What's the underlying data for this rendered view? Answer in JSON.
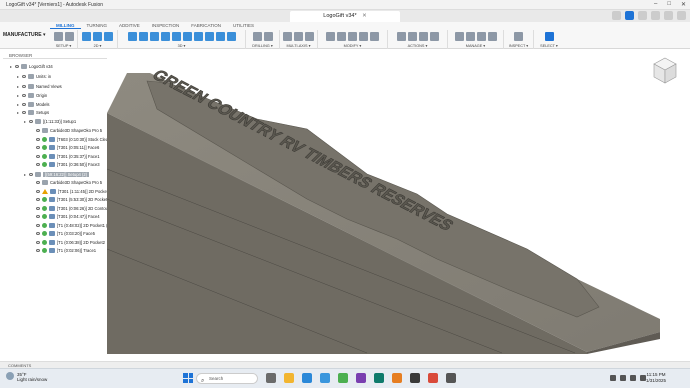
{
  "window": {
    "title": "LogoGift v34* [Verniers1] - Autodesk Fusion",
    "controls": [
      "–",
      "□",
      "✕"
    ]
  },
  "doc_tab": {
    "label": "LogoGift v34*",
    "close": "✕"
  },
  "ribbon": {
    "workspace": "MANUFACTURE ▾",
    "tabs": [
      "MILLING",
      "TURNING",
      "ADDITIVE",
      "INSPECTION",
      "FABRICATION",
      "UTILITIES"
    ],
    "active_tab": "MILLING",
    "groups": [
      "SETUP ▾",
      "2D ▾",
      "3D ▾",
      "DRILLING ▾",
      "MULTI-AXIS ▾",
      "MODIFY ▾",
      "ACTIONS ▾",
      "MANAGE ▾",
      "INSPECT ▾",
      "SELECT ▾"
    ]
  },
  "browser": {
    "header": "BROWSER",
    "rows": [
      {
        "label": "LogoGift v34",
        "indent": 0
      },
      {
        "label": "Units: in",
        "indent": 1
      },
      {
        "label": "Named Views",
        "indent": 1
      },
      {
        "label": "Origin",
        "indent": 1
      },
      {
        "label": "Models",
        "indent": 1
      },
      {
        "label": "Setups",
        "indent": 1
      },
      {
        "label": "[(1:11:33)] Setup1",
        "indent": 2
      },
      {
        "label": "Carbide3D ShapeOko Pro 5",
        "indent": 3
      },
      {
        "label": "[T603 (0:10:30)] Stock Clean",
        "indent": 3
      },
      {
        "label": "[T301 (0:05:11)] Face6",
        "indent": 3
      },
      {
        "label": "[T301 (0:35:37)] Face1",
        "indent": 3
      },
      {
        "label": "[T301 (0:36:50)] Face3",
        "indent": 3
      },
      {
        "label": "[(59:16:22)] Setup4 (2)",
        "indent": 2
      },
      {
        "label": "Carbide3D ShapeOko Pro 5",
        "indent": 3
      },
      {
        "label": "[T301 (1:11:45)] 2D Pocket1 (2)",
        "indent": 3
      },
      {
        "label": "[T301 (5:53:30)] 2D Pocket1 (6)",
        "indent": 3
      },
      {
        "label": "[T301 (0:06:26)] 2D Contour1",
        "indent": 3
      },
      {
        "label": "[T301 (0:04:47)] Face4",
        "indent": 3
      },
      {
        "label": "[T1 (0:48:02)] 2D Pocket1 (4)",
        "indent": 3
      },
      {
        "label": "[T1 (0:03:20)] Face5",
        "indent": 3
      },
      {
        "label": "[T1 (0:06:38)] 2D Pocket2",
        "indent": 3
      },
      {
        "label": "[T1 (0:02:06)] Trace1",
        "indent": 3
      }
    ]
  },
  "model": {
    "engraved_text": "GREEN COUNTRY RV TIMBERS RESERVES"
  },
  "comments": {
    "label": "COMMENTS"
  },
  "taskbar": {
    "weather_temp": "35°F",
    "weather_desc": "Light rain/snow",
    "search_placeholder": "Search",
    "time": "11:15 PM",
    "date": "1/31/2025"
  },
  "colors": {
    "accent": "#1e73d6",
    "model_top": "#8e8a80",
    "model_side": "#6f6b62"
  }
}
